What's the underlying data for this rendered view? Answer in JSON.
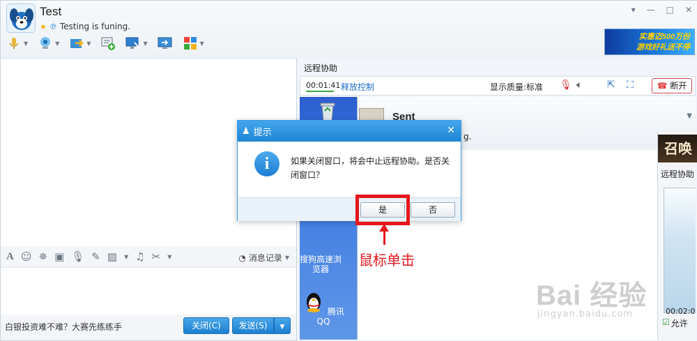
{
  "window": {
    "title": "Test",
    "signature": "Testing is funing.",
    "controls": [
      "▾",
      "—",
      "□",
      "✕"
    ]
  },
  "ad_banner": {
    "text_line1": "实惠迈500万份",
    "text_line2": "游戏好礼送不停"
  },
  "chat_toolbar": {
    "history_label": "消息记录"
  },
  "bottom": {
    "promo": "白银投资难不难？大赛先练练手",
    "close_label": "关闭(C)",
    "send_label": "发送(S)"
  },
  "remote": {
    "panel_title": "远程协助",
    "elapsed": "00:01:41",
    "release_label": "释放控制",
    "quality_label": "显示质量:标准",
    "disconnect_label": "断开",
    "inner_name": "Sent",
    "inner_sig_fragment": "g.",
    "inner_side_title": "远程协助",
    "inner_side_time": "00:02:0",
    "inner_side_check": "允许",
    "game_ad_text": "召唤",
    "desktop_icons": [
      {
        "label": "搜狗高速浏览器"
      },
      {
        "label": "腾讯QQ"
      }
    ]
  },
  "dialog": {
    "title": "提示",
    "message": "如果关闭窗口，将会中止远程协助。是否关闭窗口？",
    "yes_label": "是",
    "no_label": "否"
  },
  "annotation": {
    "caption": "鼠标单击",
    "color": "#e4171c"
  },
  "watermark": {
    "main": "Bai 经验",
    "sub": "jingyan.baidu.com"
  },
  "colors": {
    "accent_blue": "#1e86d6",
    "annotation_red": "#e4171c"
  }
}
